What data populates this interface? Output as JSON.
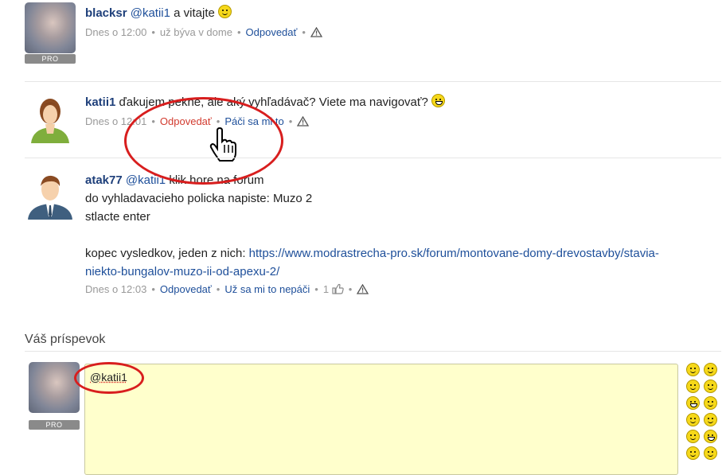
{
  "comments": [
    {
      "author": "blacksr",
      "mention": "@katii1",
      "text": "a vitajte",
      "time": "Dnes o 12:00",
      "extra": "už býva v dome",
      "reply": "Odpovedať",
      "pro_badge": "PRO"
    },
    {
      "author": "katii1",
      "text": "ďakujem pekne, ale aký vyhľadávač? Viete ma navigovať?",
      "time": "Dnes o 12:01",
      "reply": "Odpovedať",
      "like": "Páči sa mi to"
    },
    {
      "author": "atak77",
      "mention": "@katii1",
      "line1": "klik hore na forum",
      "line2": "do vyhladavacieho policka napiste: Muzo 2",
      "line3": "stlacte enter",
      "line4_prefix": "kopec vysledkov, jeden z nich:",
      "url_line1": "https://www.modrastrecha-pro.sk/forum/montovane-domy-drevostavby/stavia-",
      "url_line2": "niekto-bungalov-muzo-ii-od-apexu-2/",
      "time": "Dnes o 12:03",
      "reply": "Odpovedať",
      "unlike": "Už sa mi to nepáči",
      "like_count": "1"
    }
  ],
  "reply_section": {
    "title": "Váš príspevok",
    "textarea_value": "@katii1",
    "pro_badge": "PRO"
  },
  "colors": {
    "link": "#1e4f9a",
    "author": "#1e3f7a",
    "active_link": "#d23b2f",
    "annotation": "#d81e1e",
    "textarea_bg": "#ffffcc"
  },
  "icons": [
    "warning-icon",
    "thumbs-up-icon",
    "smiley-icon",
    "cursor-hand-icon"
  ]
}
